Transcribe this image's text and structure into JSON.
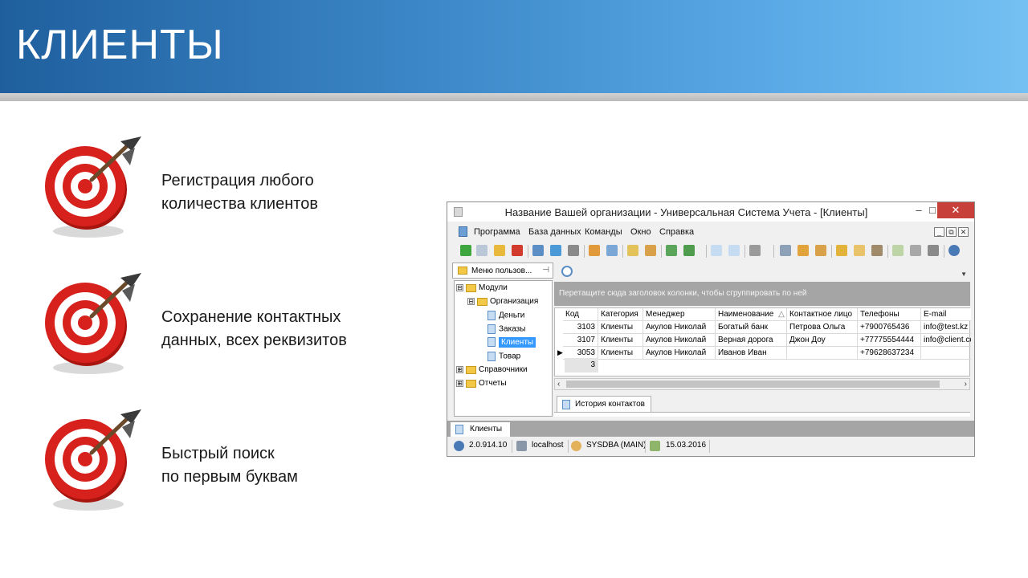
{
  "slide": {
    "title": "КЛИЕНТЫ",
    "bullets": [
      {
        "line1": "Регистрация любого",
        "line2": "количества клиентов",
        "icon": "target-icon"
      },
      {
        "line1": "Сохранение контактных",
        "line2": "данных, всех реквизитов",
        "icon": "target-icon"
      },
      {
        "line1": "Быстрый поиск",
        "line2": "по первым буквам",
        "icon": "target-icon"
      }
    ]
  },
  "window": {
    "title": "Название Вашей организации - Универсальная Система Учета - [Клиенты]",
    "controls": {
      "minimize": "–",
      "maximize": "□",
      "close": "✕"
    },
    "menu": [
      "Программа",
      "База данных",
      "Команды",
      "Окно",
      "Справка"
    ],
    "mdi_controls": [
      "_",
      "⧉",
      "✕"
    ],
    "left_panel": {
      "tab_label": "Меню пользов...",
      "tree": [
        {
          "label": "Модули",
          "level": 0,
          "expander": "⊟",
          "kind": "folder"
        },
        {
          "label": "Организация",
          "level": 1,
          "expander": "⊟",
          "kind": "folder"
        },
        {
          "label": "Деньги",
          "level": 2,
          "kind": "doc"
        },
        {
          "label": "Заказы",
          "level": 2,
          "kind": "doc"
        },
        {
          "label": "Клиенты",
          "level": 2,
          "kind": "doc",
          "selected": true
        },
        {
          "label": "Товар",
          "level": 2,
          "kind": "doc"
        },
        {
          "label": "Справочники",
          "level": 0,
          "expander": "⊞",
          "kind": "folder"
        },
        {
          "label": "Отчеты",
          "level": 0,
          "expander": "⊞",
          "kind": "folder"
        }
      ]
    },
    "grid": {
      "group_hint": "Перетащите сюда заголовок колонки, чтобы сгруппировать по ней",
      "columns": [
        "Код",
        "Категория",
        "Менеджер",
        "Наименование",
        "Контактное лицо",
        "Телефоны",
        "E-mail"
      ],
      "sort_indicator": "△",
      "rows": [
        [
          "3103",
          "Клиенты",
          "Акулов Николай",
          "Богатый банк",
          "Петрова Ольга",
          "+7900765436",
          "info@test.kz"
        ],
        [
          "3107",
          "Клиенты",
          "Акулов Николай",
          "Верная дорога",
          "Джон Доу",
          "+77775554444",
          "info@client.com"
        ],
        [
          "3053",
          "Клиенты",
          "Акулов Николай",
          "Иванов Иван",
          "",
          "+79628637234",
          ""
        ]
      ],
      "current_row_marker": "▶",
      "footer_count": "3"
    },
    "detail_tab": "История контактов",
    "document_tab": "Клиенты",
    "status": {
      "version": "2.0.914.10",
      "server": "localhost",
      "user": "SYSDBA (MAIN)",
      "date": "15.03.2016"
    }
  },
  "colors": {
    "banner_start": "#1f5f9e",
    "banner_end": "#74c0f2",
    "target_red": "#d6211c",
    "selection": "#3399ff",
    "close_button": "#c7403a"
  }
}
